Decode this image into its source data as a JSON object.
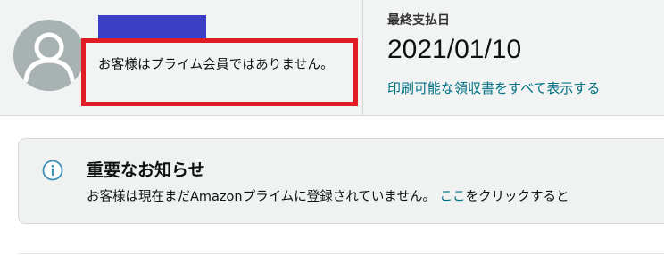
{
  "account": {
    "member_status": "お客様はプライム会員ではありません。"
  },
  "payment": {
    "label": "最終支払日",
    "date": "2021/01/10",
    "receipts_link": "印刷可能な領収書をすべて表示する"
  },
  "notice": {
    "title": "重要なお知らせ",
    "body_text": "お客様は現在まだAmazonプライムに登録されていません。",
    "link_text": "ここ",
    "trailing_text": "をクリックすると"
  },
  "colors": {
    "link": "#007185",
    "highlight_border": "#e21c24",
    "name_redaction": "#3a3fc6",
    "avatar": "#a9b2b2",
    "info_icon": "#3d8fb8"
  },
  "icons": {
    "avatar": "person-silhouette-icon",
    "notice": "info-icon"
  }
}
